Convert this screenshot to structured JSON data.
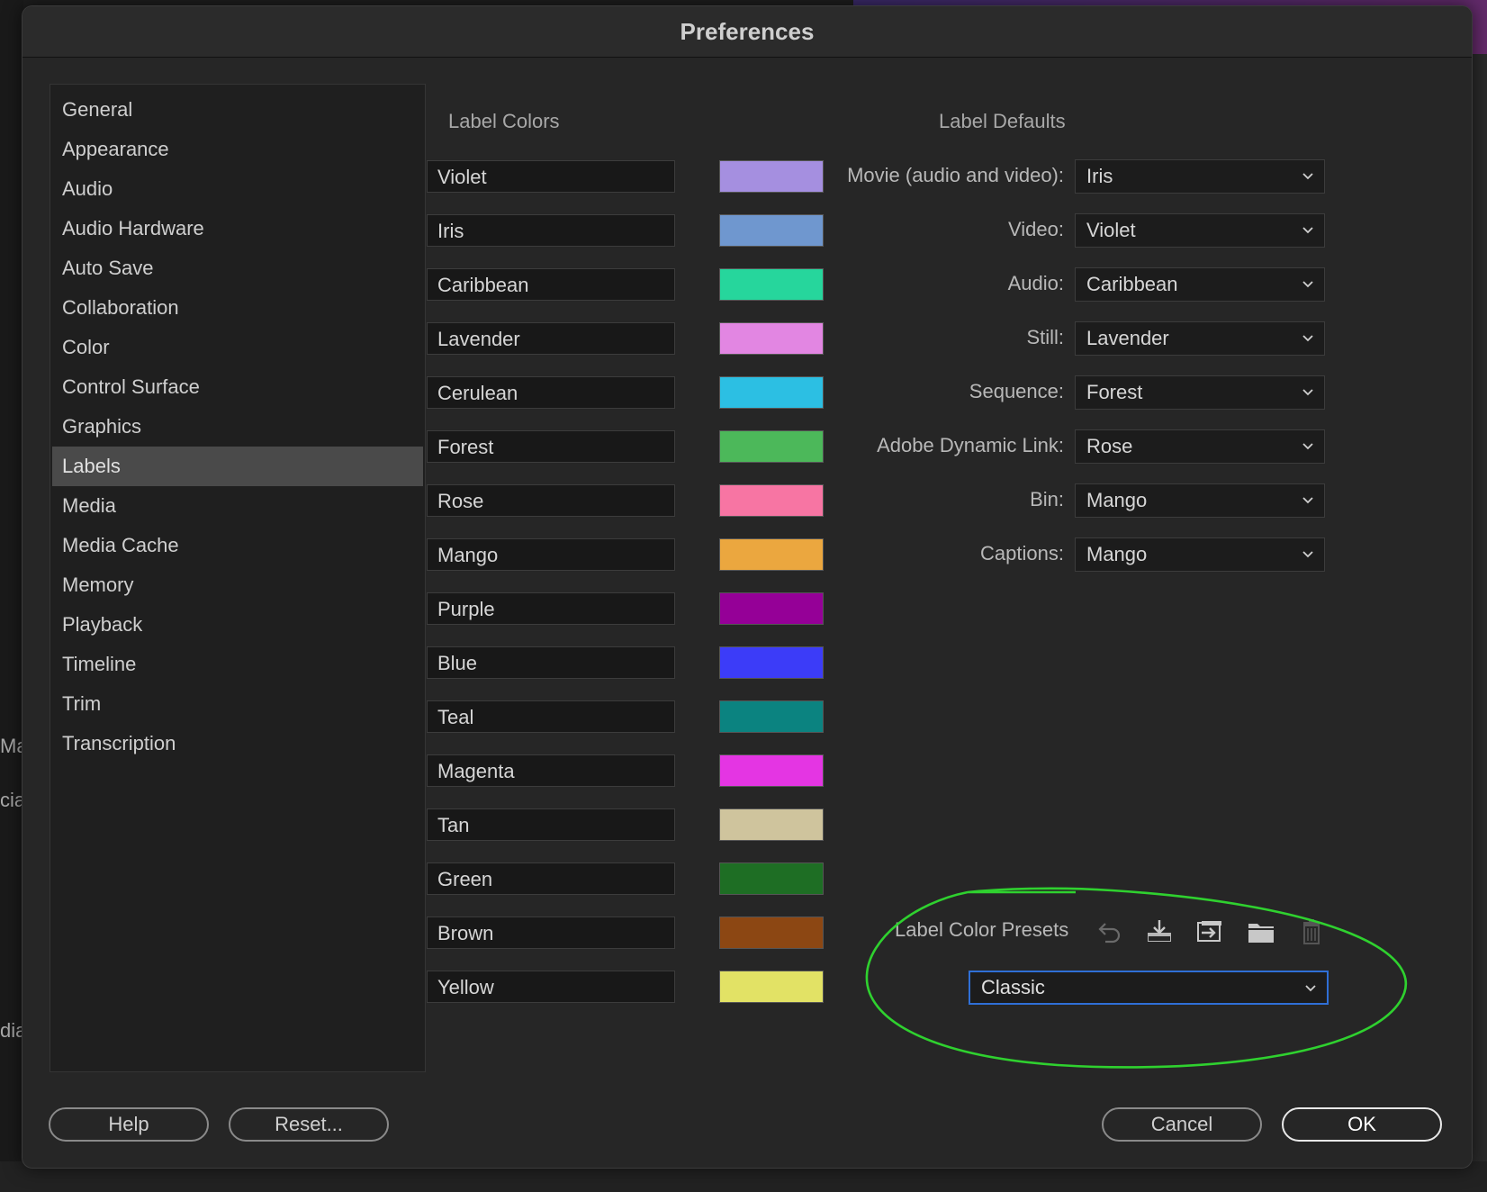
{
  "dialog": {
    "title": "Preferences"
  },
  "sidebar": {
    "items": [
      {
        "label": "General"
      },
      {
        "label": "Appearance"
      },
      {
        "label": "Audio"
      },
      {
        "label": "Audio Hardware"
      },
      {
        "label": "Auto Save"
      },
      {
        "label": "Collaboration"
      },
      {
        "label": "Color"
      },
      {
        "label": "Control Surface"
      },
      {
        "label": "Graphics"
      },
      {
        "label": "Labels",
        "selected": true
      },
      {
        "label": "Media"
      },
      {
        "label": "Media Cache"
      },
      {
        "label": "Memory"
      },
      {
        "label": "Playback"
      },
      {
        "label": "Timeline"
      },
      {
        "label": "Trim"
      },
      {
        "label": "Transcription"
      }
    ]
  },
  "label_colors": {
    "heading": "Label Colors",
    "items": [
      {
        "name": "Violet",
        "color": "#a58fe0"
      },
      {
        "name": "Iris",
        "color": "#6f97cf"
      },
      {
        "name": "Caribbean",
        "color": "#26d69c"
      },
      {
        "name": "Lavender",
        "color": "#e286e2"
      },
      {
        "name": "Cerulean",
        "color": "#2cbfe3"
      },
      {
        "name": "Forest",
        "color": "#4cb85a"
      },
      {
        "name": "Rose",
        "color": "#f775a3"
      },
      {
        "name": "Mango",
        "color": "#eba73f"
      },
      {
        "name": "Purple",
        "color": "#950097"
      },
      {
        "name": "Blue",
        "color": "#3c3cf8"
      },
      {
        "name": "Teal",
        "color": "#0b8380"
      },
      {
        "name": "Magenta",
        "color": "#e435e3"
      },
      {
        "name": "Tan",
        "color": "#cfc49d"
      },
      {
        "name": "Green",
        "color": "#1e6e24"
      },
      {
        "name": "Brown",
        "color": "#8c4713"
      },
      {
        "name": "Yellow",
        "color": "#e2e265"
      }
    ]
  },
  "label_defaults": {
    "heading": "Label Defaults",
    "rows": [
      {
        "label": "Movie (audio and video):",
        "value": "Iris"
      },
      {
        "label": "Video:",
        "value": "Violet"
      },
      {
        "label": "Audio:",
        "value": "Caribbean"
      },
      {
        "label": "Still:",
        "value": "Lavender"
      },
      {
        "label": "Sequence:",
        "value": "Forest"
      },
      {
        "label": "Adobe Dynamic Link:",
        "value": "Rose"
      },
      {
        "label": "Bin:",
        "value": "Mango"
      },
      {
        "label": "Captions:",
        "value": "Mango"
      }
    ]
  },
  "presets": {
    "label": "Label Color Presets",
    "selected": "Classic",
    "icons": [
      "undo-icon",
      "import-icon",
      "export-icon",
      "folder-icon",
      "trash-icon"
    ],
    "annotation_color": "#2fd12f"
  },
  "buttons": {
    "help": "Help",
    "reset": "Reset...",
    "cancel": "Cancel",
    "ok": "OK"
  },
  "background": {
    "left_fragments": [
      "Mar",
      "cia",
      "dia"
    ]
  }
}
